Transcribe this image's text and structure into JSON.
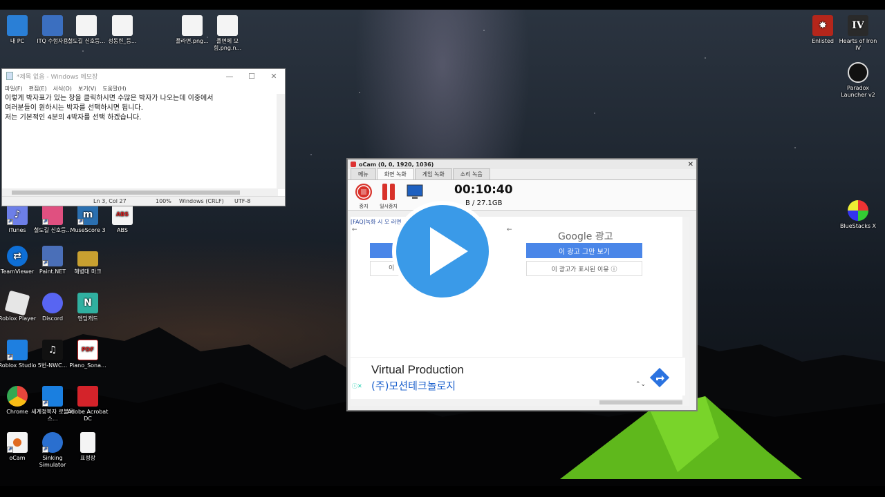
{
  "desktop": {
    "icons_left": [
      {
        "label": "내 PC",
        "color": "#2a7fd6",
        "glyph": ""
      },
      {
        "label": "ITQ 수험자용",
        "color": "#3b6fc0",
        "glyph": ""
      },
      {
        "label": "철도길 신호등...",
        "color": "#f4f4f4",
        "glyph": ""
      },
      {
        "label": "성동힌_등...",
        "color": "#f4f4f4",
        "glyph": ""
      },
      {
        "label": "플라면.png...",
        "color": "#f4f4f4",
        "glyph": ""
      },
      {
        "label": "플면에 모힘.png.n...",
        "color": "#f4f4f4",
        "glyph": ""
      }
    ],
    "icons_grid": [
      {
        "label": "iTunes",
        "color": "#6d7fe8",
        "glyph": "♪"
      },
      {
        "label": "철도길 신호등...",
        "color": "#e05080",
        "glyph": ""
      },
      {
        "label": "MuseScore 3",
        "color": "#2a6fb0",
        "glyph": "m"
      },
      {
        "label": "ABS",
        "color": "#f4f4f4",
        "glyph": "ABS"
      },
      {
        "label": "TeamViewer",
        "color": "#0e6fd6",
        "glyph": "⇄"
      },
      {
        "label": "Paint.NET",
        "color": "#4a6fb8",
        "glyph": ""
      },
      {
        "label": "해병대 마크",
        "color": "#c8a030",
        "glyph": ""
      },
      {
        "label": "Roblox Player",
        "color": "#e6e6e6",
        "glyph": ""
      },
      {
        "label": "Discord",
        "color": "#5865f2",
        "glyph": ""
      },
      {
        "label": "엔딩캐드",
        "color": "#30b0a0",
        "glyph": "N"
      },
      {
        "label": "Roblox Studio",
        "color": "#1e7fe0",
        "glyph": ""
      },
      {
        "label": "5번-NWC...",
        "color": "#111111",
        "glyph": "♫"
      },
      {
        "label": "Piano_Sona...",
        "color": "#ffffff",
        "glyph": "PDF"
      },
      {
        "label": "Chrome",
        "color": "#e8453c",
        "glyph": ""
      },
      {
        "label": "세계정복자 로블록스...",
        "color": "#1a7fe0",
        "glyph": ""
      },
      {
        "label": "Adobe Acrobat DC",
        "color": "#d4232a",
        "glyph": ""
      },
      {
        "label": "oCam",
        "color": "#f4f4f4",
        "glyph": ""
      },
      {
        "label": "Sinking Simulator",
        "color": "#2a6fcf",
        "glyph": ""
      },
      {
        "label": "표정장",
        "color": "#f4f4f4",
        "glyph": ""
      }
    ],
    "icons_right": [
      {
        "label": "Enlisted",
        "color": "#b4261b",
        "glyph": "✸"
      },
      {
        "label": "Hearts of Iron IV",
        "color": "#2a2a2a",
        "glyph": "IV"
      },
      {
        "label": "Paradox Launcher v2",
        "color": "#111111",
        "glyph": ""
      },
      {
        "label": "BlueStacks X",
        "color": "#ffffff",
        "glyph": ""
      }
    ]
  },
  "notepad": {
    "title": "*제목 없음 - Windows 메모장",
    "menu": [
      "파일(F)",
      "편집(E)",
      "서식(O)",
      "보기(V)",
      "도움말(H)"
    ],
    "lines": [
      "이렇게 박자표가 있는 창을 클릭하시면 수많은 박자가 나오는데 이중에서",
      "여러분들이 원하시는 박자를 선택하시면 됩니다.",
      "저는 기본적인 4분의 4박자를 선택 하겠습니다."
    ],
    "status": {
      "position": "Ln 3, Col 27",
      "zoom": "100%",
      "eol": "Windows (CRLF)",
      "encoding": "UTF-8"
    },
    "controls": {
      "minimize": "—",
      "maximize": "☐",
      "close": "✕"
    }
  },
  "ocam": {
    "title": "oCam (0, 0, 1920, 1036)",
    "close": "✕",
    "tabs": [
      "메뉴",
      "화면 녹화",
      "게임 녹화",
      "소리 녹음"
    ],
    "active_tab": 1,
    "buttons": {
      "stop": "중지",
      "pause": "일시중지"
    },
    "time": "00:10:40",
    "size": "B / 27.1GB",
    "faq": "[FAQ]녹화 시 오                               러면",
    "google_title": "Google 광고",
    "stop_ad": "이 광고 그만 보기",
    "why_ad": "이 광고가 표시된 이유 ⓘ",
    "left_gray": "이",
    "ad_title": "Virtual Production",
    "ad_company": "(주)모션테크놀로지"
  },
  "colors": {
    "accent_blue": "#4a86e8",
    "play_blue": "#3a9ae8",
    "ocam_red": "#d8322a"
  }
}
